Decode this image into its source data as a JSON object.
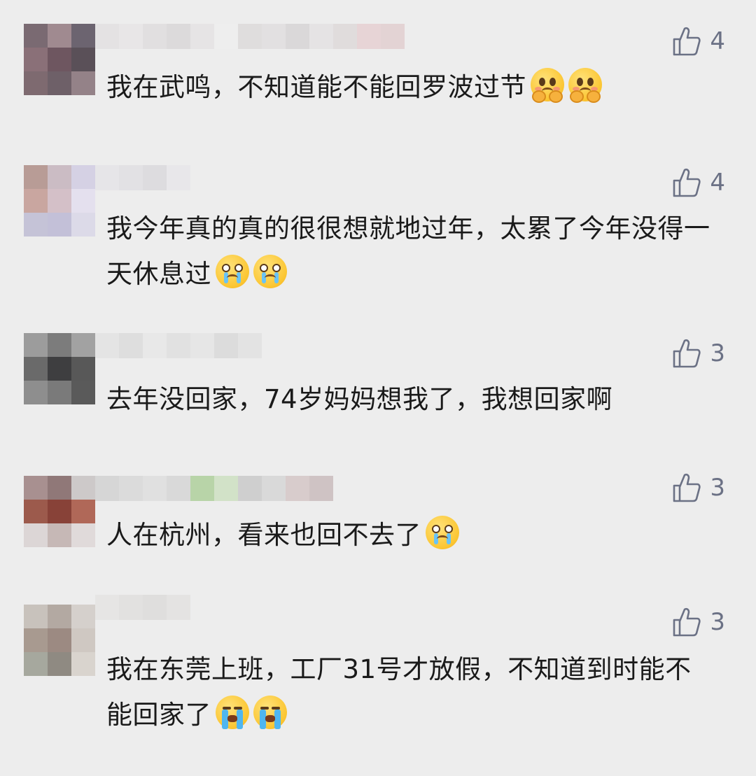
{
  "comments": [
    {
      "like_count": "4",
      "text": "我在武鸣，不知道能不能回罗波过节",
      "emojis": [
        "pleading-face-emoji",
        "pleading-face-emoji"
      ],
      "avatar_colors": [
        "#7a6a72",
        "#a08a90",
        "#6c6470",
        "#8a7078",
        "#6e5660",
        "#5a5058",
        "#7e6a70",
        "#6e6068",
        "#948288"
      ],
      "name_colors": [
        "#e4e2e3",
        "#e8e6e7",
        "#e1dfe0",
        "#dcdadb",
        "#e6e4e5",
        "#eeeeee",
        "#dfdddd",
        "#e2e0e1",
        "#dad8d9",
        "#e5e3e4",
        "#e0dcdc",
        "#e7d4d6",
        "#e3d3d4"
      ]
    },
    {
      "like_count": "4",
      "text": "我今年真的真的很很想就地过年，太累了今年没得一天休息过",
      "emojis": [
        "crying-face-emoji",
        "crying-face-emoji"
      ],
      "avatar_colors": [
        "#b89c96",
        "#cbbcc4",
        "#d5d1e4",
        "#c9a6a0",
        "#d4c0c8",
        "#e4e0ee",
        "#c5c3d7",
        "#c3c0d8",
        "#dcdae8"
      ],
      "name_colors": [
        "#e6e5e8",
        "#e2e1e4",
        "#dddcdf",
        "#e8e7ea"
      ]
    },
    {
      "like_count": "3",
      "text": "去年没回家，74岁妈妈想我了，我想回家啊",
      "emojis": [],
      "avatar_colors": [
        "#9c9c9c",
        "#7c7c7c",
        "#a2a2a2",
        "#6a6a6a",
        "#3e3e40",
        "#585858",
        "#8e8e8e",
        "#7a7a7a",
        "#5a5a5a"
      ],
      "name_colors": [
        "#e4e4e4",
        "#dedede",
        "#e8e8e8",
        "#e1e1e1",
        "#e6e6e6",
        "#dcdcdc",
        "#e3e3e3"
      ]
    },
    {
      "like_count": "3",
      "text": "人在杭州，看来也回不去了",
      "emojis": [
        "crying-face-emoji"
      ],
      "avatar_colors": [
        "#a89090",
        "#907878",
        "#cdc9c9",
        "#9c5a4c",
        "#884238",
        "#b06858",
        "#dcd6d6",
        "#c6b8b6",
        "#e0dada"
      ],
      "name_colors": [
        "#d6d6d6",
        "#dbdbdb",
        "#e0e0e0",
        "#d9d9d9",
        "#b8d4a8",
        "#d2e2c8",
        "#cfcfcf",
        "#d9d9d9",
        "#d8cccc",
        "#cfc3c4"
      ]
    },
    {
      "like_count": "3",
      "text": "我在东莞上班，工厂31号才放假，不知道到时能不能回家了",
      "emojis": [
        "loudly-crying-face-emoji",
        "loudly-crying-face-emoji"
      ],
      "avatar_colors": [
        "#c8c2bc",
        "#b3a9a2",
        "#d5d0cc",
        "#a89a90",
        "#9c8a82",
        "#cfc8c2",
        "#a6a89e",
        "#8f8a82",
        "#d9d4ce"
      ],
      "name_colors": [
        "#e6e5e4",
        "#e2e1e0",
        "#dfdedd",
        "#e4e3e2"
      ]
    }
  ]
}
